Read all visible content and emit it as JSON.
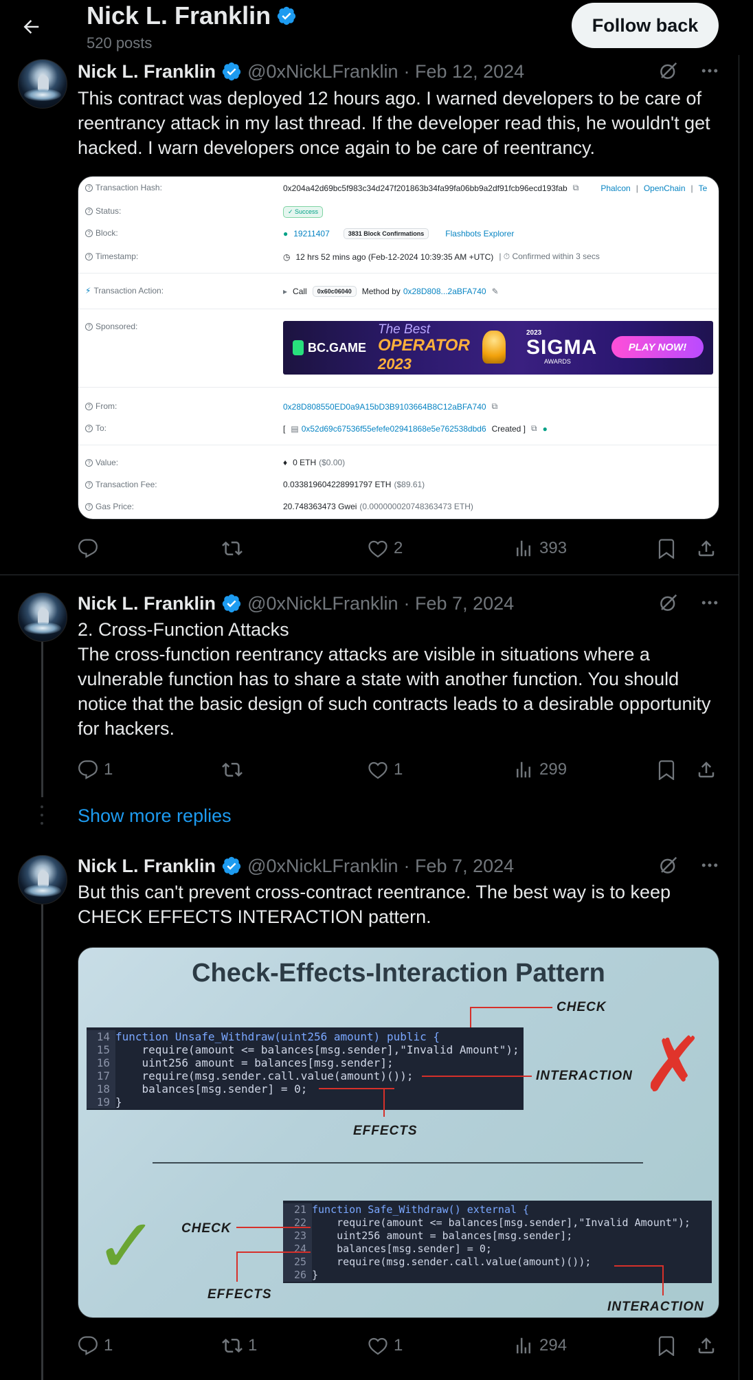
{
  "header": {
    "title": "Nick L. Franklin",
    "posts": "520 posts",
    "follow_label": "Follow back"
  },
  "tweets": [
    {
      "name": "Nick L. Franklin",
      "handle": "@0xNickLFranklin",
      "date": "· Feb 12, 2024",
      "text": "This contract was deployed 12 hours ago. I warned developers to be care of reentrancy attack in my last thread. If the developer read this, he wouldn't get hacked. I warn developers once again to be care of reentrancy.",
      "replies": "",
      "reposts": "",
      "likes": "2",
      "views": "393"
    },
    {
      "name": "Nick L. Franklin",
      "handle": "@0xNickLFranklin",
      "date": "· Feb 7, 2024",
      "text": "2. Cross-Function Attacks\nThe cross-function reentrancy attacks are visible in situations where a vulnerable function has to share a state with another function. You should notice that the basic design of such contracts leads to a desirable opportunity for hackers.",
      "replies": "1",
      "reposts": "",
      "likes": "1",
      "views": "299"
    },
    {
      "name": "Nick L. Franklin",
      "handle": "@0xNickLFranklin",
      "date": "· Feb 7, 2024",
      "text": "But this can't prevent cross-contract reentrance. The best way is to keep CHECK EFFECTS INTERACTION pattern.",
      "replies": "1",
      "reposts": "1",
      "likes": "1",
      "views": "294"
    }
  ],
  "show_more": "Show more replies",
  "tx": {
    "hash_label": "Transaction Hash:",
    "hash": "0x204a42d69bc5f983c34d247f201863b34fa99fa06bb9a2df91fcb96ecd193fab",
    "hash_links": [
      "Phalcon",
      "OpenChain"
    ],
    "status_label": "Status:",
    "status": "Success",
    "block_label": "Block:",
    "block": "19211407",
    "confirmations": "3831 Block Confirmations",
    "block_link": "Flashbots Explorer",
    "timestamp_label": "Timestamp:",
    "timestamp": "12 hrs 52 mins ago (Feb-12-2024 10:39:35 AM +UTC)",
    "timestamp_note": "| ⏱ Confirmed within 3 secs",
    "action_label": "Transaction Action:",
    "action_call": "Call",
    "action_method": "0x60c06040",
    "action_by": "Method by",
    "action_addr": "0x28D808...2aBFA740",
    "sponsored_label": "Sponsored:",
    "from_label": "From:",
    "from": "0x28D808550ED0a9A15bD3B9103664B8C12aBFA740",
    "to_label": "To:",
    "to": "0x52d69c67536f55efefe02941868e5e762538dbd6",
    "to_created": "Created ]",
    "value_label": "Value:",
    "value": "0 ETH",
    "value_usd": "($0.00)",
    "fee_label": "Transaction Fee:",
    "fee": "0.033819604228991797 ETH",
    "fee_usd": "($89.61)",
    "gas_label": "Gas Price:",
    "gas": "20.748363473 Gwei",
    "gas_eth": "(0.000000020748363473 ETH)"
  },
  "banner": {
    "brand": "BC.GAME",
    "line1": "The Best",
    "line2": "OPERATOR",
    "line3": "2023",
    "sigma_year": "2023",
    "sigma": "SIGMA",
    "awards": "AWARDS",
    "cta": "PLAY NOW!"
  },
  "pattern": {
    "title": "Check-Effects-Interaction Pattern",
    "label_check": "CHECK",
    "label_interaction": "INTERACTION",
    "label_effects": "EFFECTS",
    "unsafe_lines": [
      {
        "n": "14",
        "code": "function Unsafe_Withdraw(uint256 amount) public {"
      },
      {
        "n": "15",
        "code": "    require(amount <= balances[msg.sender],\"Invalid Amount\");"
      },
      {
        "n": "16",
        "code": "    uint256 amount = balances[msg.sender];"
      },
      {
        "n": "17",
        "code": "    require(msg.sender.call.value(amount)());"
      },
      {
        "n": "18",
        "code": "    balances[msg.sender] = 0;"
      },
      {
        "n": "19",
        "code": "}"
      }
    ],
    "safe_lines": [
      {
        "n": "21",
        "code": "function Safe_Withdraw() external {"
      },
      {
        "n": "22",
        "code": "    require(amount <= balances[msg.sender],\"Invalid Amount\");"
      },
      {
        "n": "23",
        "code": "    uint256 amount = balances[msg.sender];"
      },
      {
        "n": "24",
        "code": "    balances[msg.sender] = 0;"
      },
      {
        "n": "25",
        "code": "    require(msg.sender.call.value(amount)());"
      },
      {
        "n": "26",
        "code": "}"
      }
    ]
  },
  "colors": {
    "accent_blue": "#1d9bf0",
    "muted": "#71767b",
    "text": "#e7e9ea",
    "verified": "#1d9bf0"
  },
  "icons": [
    "back-arrow-icon",
    "verified-icon",
    "grok-icon",
    "more-icon",
    "reply-icon",
    "repost-icon",
    "like-icon",
    "views-icon",
    "bookmark-icon",
    "share-icon"
  ]
}
